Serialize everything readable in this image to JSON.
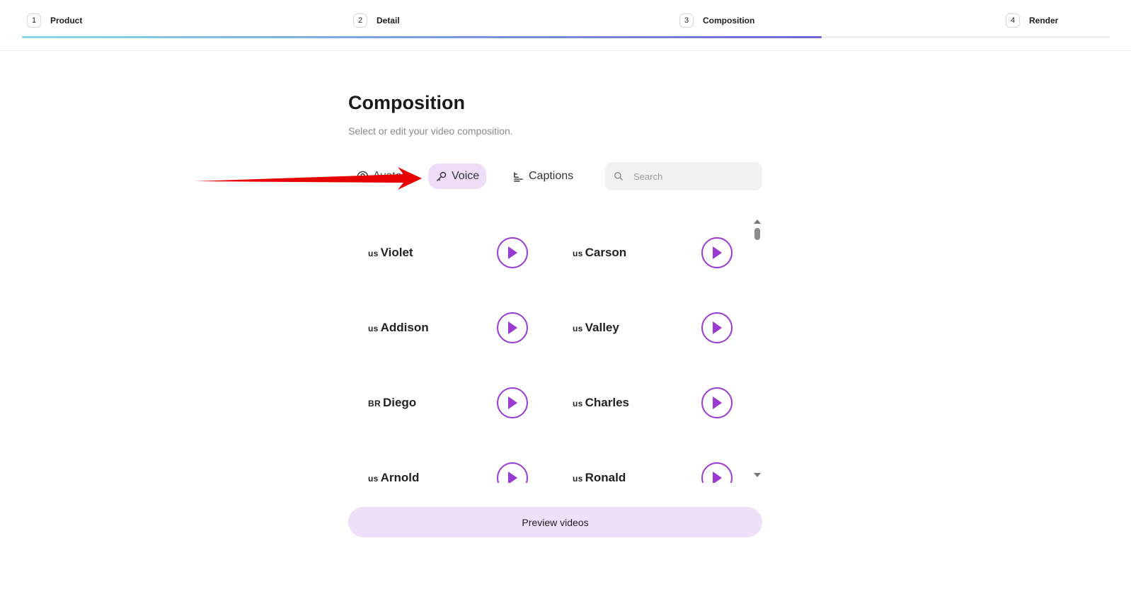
{
  "stepper": {
    "steps": [
      {
        "num": "1",
        "label": "Product"
      },
      {
        "num": "2",
        "label": "Detail"
      },
      {
        "num": "3",
        "label": "Composition"
      },
      {
        "num": "4",
        "label": "Render"
      }
    ],
    "progress_percent": 73.5
  },
  "page": {
    "title": "Composition",
    "subtitle": "Select or edit your video composition."
  },
  "tabs": {
    "avatar": {
      "label": "Avatar",
      "icon": "avatar-icon"
    },
    "voice": {
      "label": "Voice",
      "icon": "microphone-icon",
      "active": true
    },
    "captions": {
      "label": "Captions",
      "icon": "captions-icon"
    }
  },
  "search": {
    "placeholder": "Search",
    "value": ""
  },
  "voices": [
    {
      "flag": "US",
      "name": "Violet"
    },
    {
      "flag": "US",
      "name": "Carson"
    },
    {
      "flag": "US",
      "name": "Addison"
    },
    {
      "flag": "US",
      "name": "Valley"
    },
    {
      "flag": "BR",
      "name": "Diego"
    },
    {
      "flag": "US",
      "name": "Charles"
    },
    {
      "flag": "US",
      "name": "Arnold"
    },
    {
      "flag": "US",
      "name": "Ronald"
    }
  ],
  "actions": {
    "preview_label": "Preview videos"
  },
  "colors": {
    "accent": "#9b39d3",
    "tab_active_bg": "#eedcf8",
    "preview_bg": "#efe0fa",
    "annotation_arrow": "#e60000"
  }
}
